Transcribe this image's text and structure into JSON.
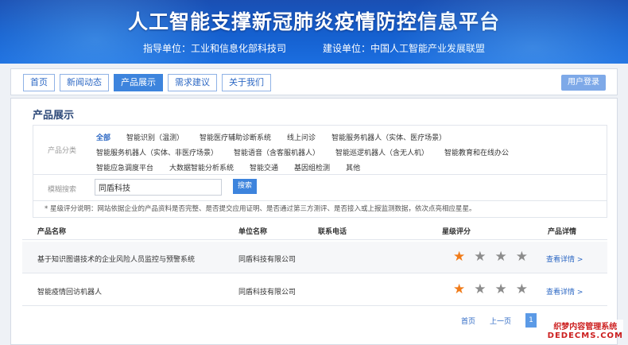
{
  "header": {
    "title": "人工智能支撑新冠肺炎疫情防控信息平台",
    "guide_unit": "指导单位：工业和信息化部科技司",
    "build_unit": "建设单位：中国人工智能产业发展联盟"
  },
  "nav": {
    "tabs": [
      "首页",
      "新闻动态",
      "产品展示",
      "需求建议",
      "关于我们"
    ],
    "active_tab": "产品展示",
    "login_label": "用户登录"
  },
  "main": {
    "section_title": "产品展示",
    "filter": {
      "label": "产品分类",
      "rows": [
        [
          "全部",
          "智能识别（温测）",
          "智能医疗辅助诊断系统",
          "线上问诊",
          "智能服务机器人（实体、医疗场景）"
        ],
        [
          "智能服务机器人（实体、非医疗场景）",
          "智能语音（含客服机器人）",
          "智能巡逻机器人（含无人机）",
          "智能教育和在线办公"
        ],
        [
          "智能应急调度平台",
          "大数据智能分析系统",
          "智能交通",
          "基因组检测",
          "其他"
        ]
      ],
      "selected": "全部"
    },
    "search": {
      "label": "模糊搜索",
      "value": "同盾科技",
      "button_label": "搜索"
    },
    "note": "* 星级评分说明：网站依据企业的产品资料是否完整、是否提交应用证明、是否通过第三方测评、是否接入或上报监测数据，依次点亮相应星星。",
    "table": {
      "headers": [
        "产品名称",
        "单位名称",
        "联系电话",
        "星级评分",
        "产品详情"
      ],
      "rows": [
        {
          "name": "基于知识图谱技术的企业风险人员监控与预警系统",
          "org": "同盾科技有限公司",
          "phone": "",
          "stars_lit": 1,
          "stars_total": 4,
          "detail": "查看详情 >"
        },
        {
          "name": "智能疫情回访机器人",
          "org": "同盾科技有限公司",
          "phone": "",
          "stars_lit": 1,
          "stars_total": 4,
          "detail": "查看详情 >"
        }
      ]
    },
    "pagination": {
      "first": "首页",
      "prev": "上一页",
      "current": "1"
    }
  },
  "watermark": {
    "line1": "织梦内容管理系统",
    "line2": "DEDECMS.COM"
  },
  "colors": {
    "brand_blue": "#1560cf",
    "accent": "#3d84dd",
    "star_on": "#f07b19",
    "star_off": "#8c8c8c"
  }
}
